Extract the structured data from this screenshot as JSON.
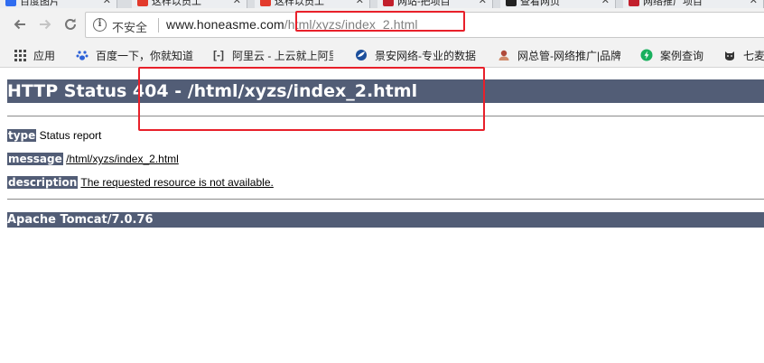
{
  "tabs": [
    {
      "label": "百度图片",
      "fav_color": "#2f6cf0"
    },
    {
      "label": "这样以员工",
      "fav_color": "#e23a2c"
    },
    {
      "label": "这样以员工",
      "fav_color": "#e23a2c"
    },
    {
      "label": "网站-把项目",
      "fav_color": "#c21f2c"
    },
    {
      "label": "查看网页",
      "fav_color": "#222222"
    },
    {
      "label": "网络推广项目",
      "fav_color": "#c21f2c"
    }
  ],
  "toolbar": {
    "back_icon": "back-arrow-icon",
    "forward_icon": "forward-arrow-icon",
    "reload_icon": "reload-icon",
    "insecure_label": "不安全",
    "url_host": "www.honeasme.com",
    "url_path": "/html/xyzs/index_2.html"
  },
  "bookmarks": {
    "apps_label": "应用",
    "items": [
      {
        "label": "百度一下，你就知道",
        "icon": "baidu-paw-icon",
        "color": "#2d62d8"
      },
      {
        "label": "阿里云 - 上云就上阿里",
        "icon": "aliyun-icon",
        "color": "#444444"
      },
      {
        "label": "景安网络-专业的数据",
        "icon": "jingan-icon",
        "color": "#1c4f9c"
      },
      {
        "label": "网总管-网络推广|品牌",
        "icon": "avatar-icon",
        "color": "#b04a3a"
      },
      {
        "label": "案例查询",
        "icon": "green-bolt-icon",
        "color": "#19b05e"
      },
      {
        "label": "七麦",
        "icon": "cat-icon",
        "color": "#333333"
      }
    ]
  },
  "page": {
    "heading": "HTTP Status 404 - /html/xyzs/index_2.html",
    "type_label": "type",
    "type_value": "Status report",
    "message_label": "message",
    "message_value": "/html/xyzs/index_2.html",
    "description_label": "description",
    "description_value": "The requested resource is not available.",
    "footer": "Apache Tomcat/7.0.76"
  },
  "annotation_color": "#e8202a"
}
